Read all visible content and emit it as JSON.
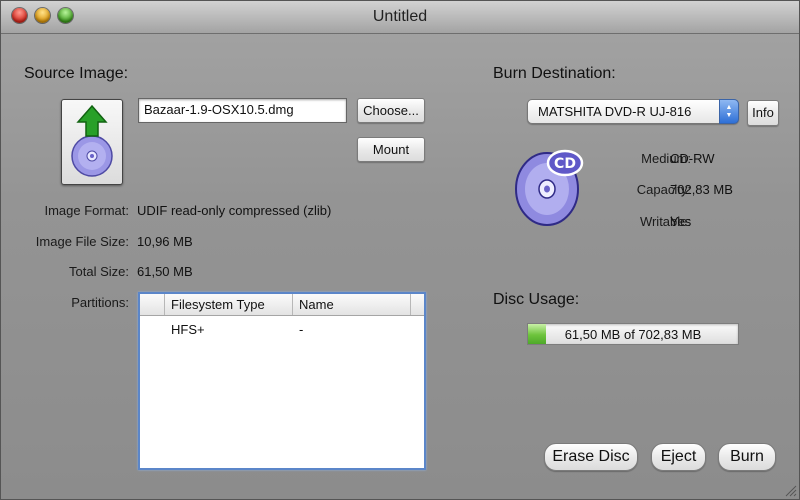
{
  "window": {
    "title": "Untitled"
  },
  "source": {
    "heading": "Source Image:",
    "filename": "Bazaar-1.9-OSX10.5.dmg",
    "choose_label": "Choose...",
    "mount_label": "Mount",
    "image_format_label": "Image Format:",
    "image_format_value": "UDIF read-only compressed (zlib)",
    "image_size_label": "Image File Size:",
    "image_size_value": "10,96 MB",
    "total_size_label": "Total Size:",
    "total_size_value": "61,50 MB",
    "partitions_label": "Partitions:",
    "partitions": {
      "columns": [
        "Filesystem Type",
        "Name"
      ],
      "rows": [
        {
          "filesystem": "HFS+",
          "name": "-"
        }
      ]
    }
  },
  "destination": {
    "heading": "Burn Destination:",
    "drive": "MATSHITA DVD-R UJ-816",
    "info_label": "Info",
    "medium_label": "Medium:",
    "medium_value": "CD-RW",
    "capacity_label": "Capacity:",
    "capacity_value": "702,83 MB",
    "writable_label": "Writable:",
    "writable_value": "Yes",
    "cd_badge": "CD"
  },
  "usage": {
    "heading": "Disc Usage:",
    "text": "61,50 MB of 702,83 MB",
    "fraction": 0.0875
  },
  "actions": {
    "erase_label": "Erase Disc",
    "eject_label": "Eject",
    "burn_label": "Burn"
  },
  "colors": {
    "progress_green": "#6dc33c",
    "disc_purple": "#6a63c9",
    "arrow_green": "#28a028"
  }
}
